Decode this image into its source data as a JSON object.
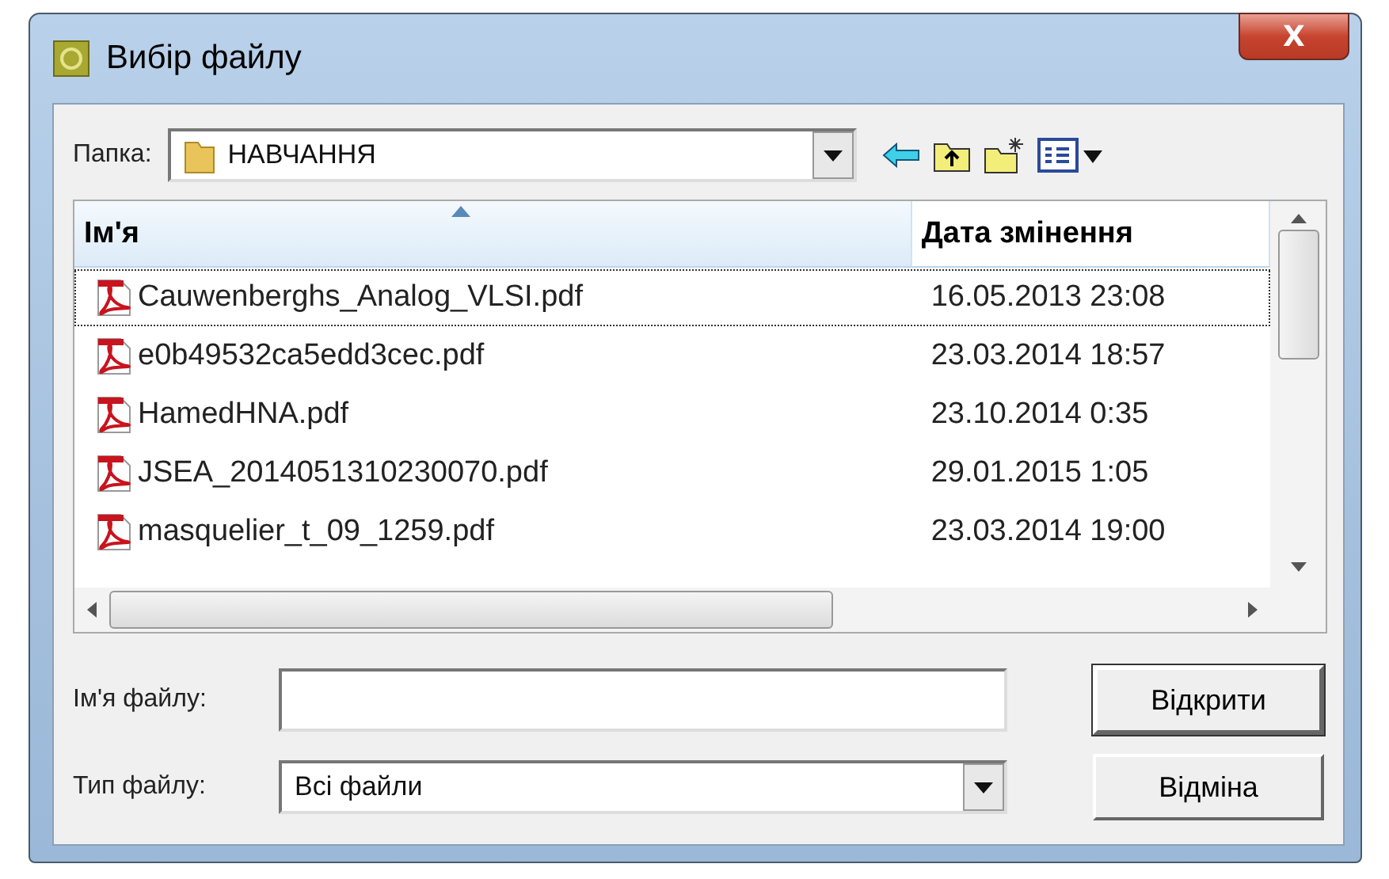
{
  "window": {
    "title": "Вибір файлу",
    "close_label": "X"
  },
  "folder": {
    "label": "Папка:",
    "value": "НАВЧАННЯ"
  },
  "table": {
    "columns": [
      {
        "label": "Ім'я",
        "sorted": true
      },
      {
        "label": "Дата змінення",
        "sorted": false
      }
    ],
    "rows": [
      {
        "name": "Cauwenberghs_Analog_VLSI.pdf",
        "modified": "16.05.2013 23:08",
        "selected": true
      },
      {
        "name": "e0b49532ca5edd3cec.pdf",
        "modified": "23.03.2014 18:57",
        "selected": false
      },
      {
        "name": "HamedHNA.pdf",
        "modified": "23.10.2014 0:35",
        "selected": false
      },
      {
        "name": "JSEA_2014051310230070.pdf",
        "modified": "29.01.2015 1:05",
        "selected": false
      },
      {
        "name": "masquelier_t_09_1259.pdf",
        "modified": "23.03.2014 19:00",
        "selected": false
      }
    ]
  },
  "file_name": {
    "label": "Ім'я файлу:"
  },
  "file_type": {
    "label": "Тип файлу:",
    "value": "Всі файли"
  },
  "buttons": [
    {
      "label": "Відкрити",
      "kind": "default"
    },
    {
      "label": "Відміна",
      "kind": "normal"
    }
  ]
}
